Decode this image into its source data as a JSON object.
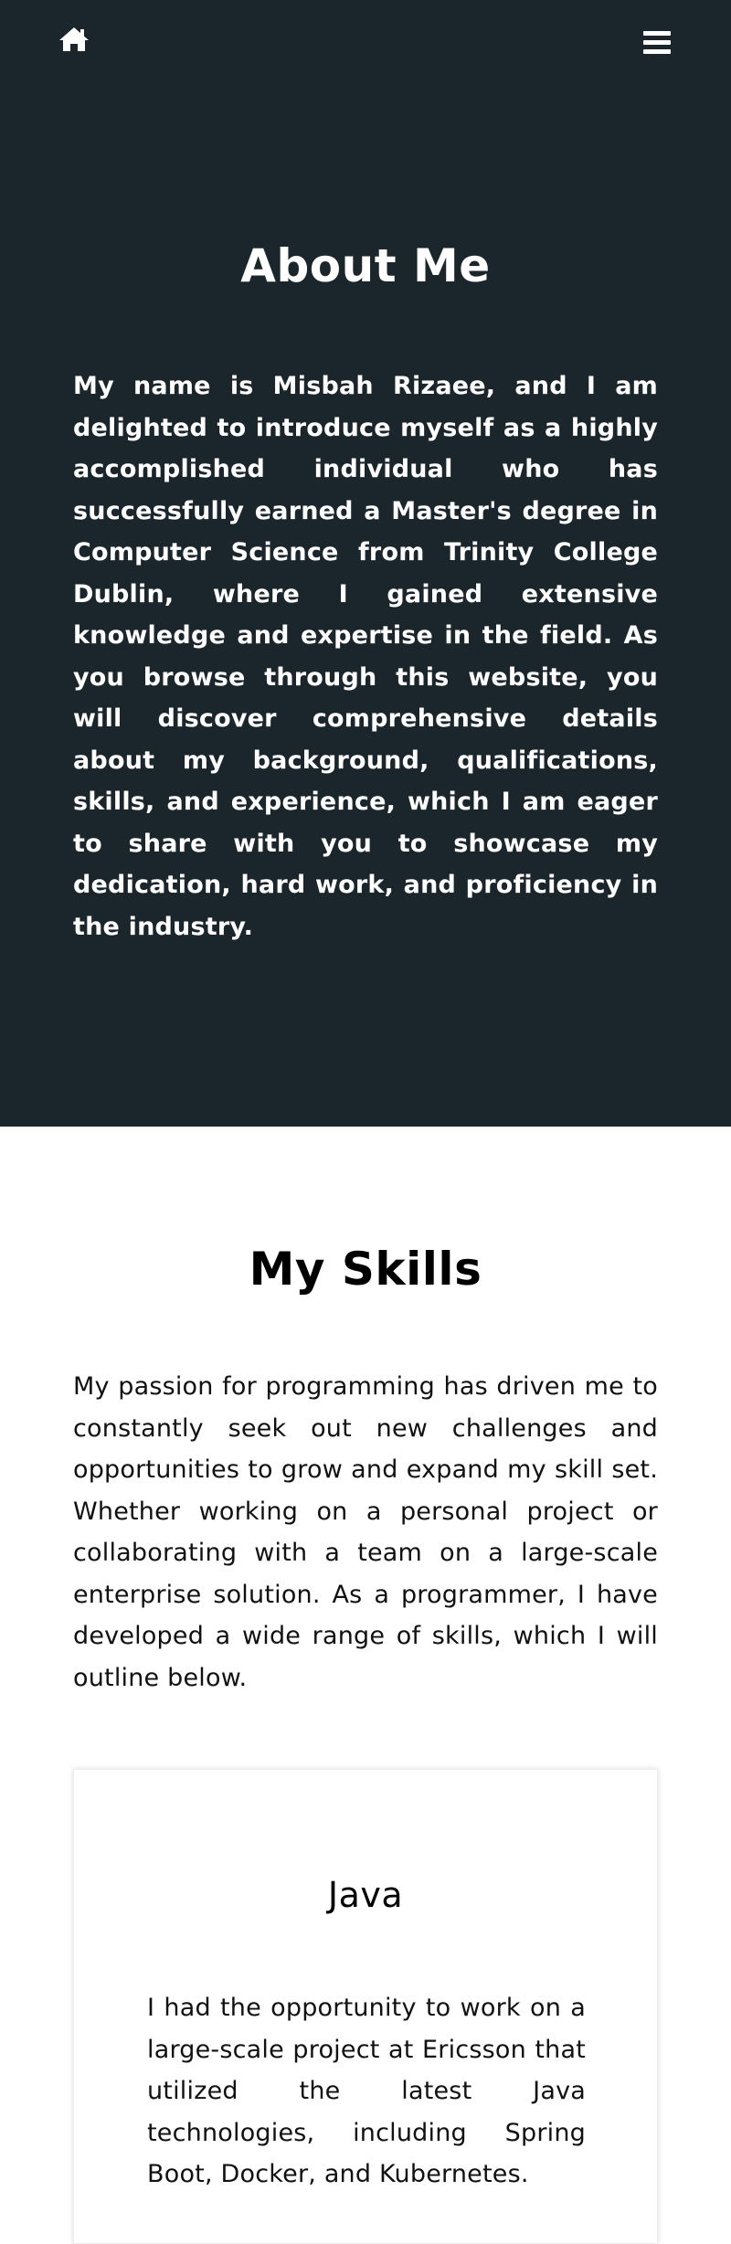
{
  "nav": {
    "home_icon": "home-icon",
    "menu_icon": "hamburger-menu-icon",
    "background": "#1b252c"
  },
  "about": {
    "title": "About Me",
    "text": "My name is Misbah Rizaee, and I am delighted to introduce myself as a highly accomplished individual who has successfully earned a Master's degree in Computer Science from Trinity College Dublin, where I gained extensive knowledge and expertise in the field. As you browse through this website, you will discover comprehensive details about my background, qualifications, skills, and experience, which I am eager to share with you to showcase my dedication, hard work, and proficiency in the industry."
  },
  "skills": {
    "title": "My Skills",
    "intro": "My passion for programming has driven me to constantly seek out new challenges and opportunities to grow and expand my skill set. Whether working on a personal project or collaborating with a team on a large-scale enterprise solution. As a programmer, I have developed a wide range of skills, which I will outline below.",
    "cards": [
      {
        "title": "Java",
        "text": "I had the opportunity to work on a large-scale project at Ericsson that utilized the latest Java technologies, including Spring Boot, Docker, and Kubernetes."
      }
    ]
  }
}
